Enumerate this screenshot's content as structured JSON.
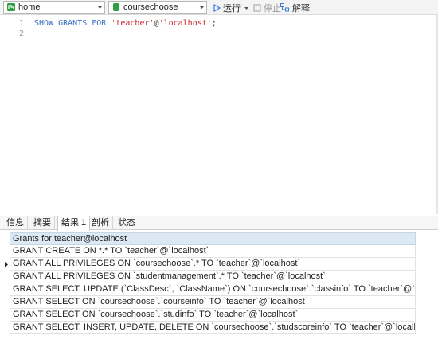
{
  "toolbar": {
    "connection": "home",
    "database": "coursechoose",
    "run_label": "运行",
    "stop_label": "停止",
    "explain_label": "解释"
  },
  "editor": {
    "line_numbers": [
      "1",
      "2"
    ],
    "line1": {
      "kw": "SHOW GRANTS FOR ",
      "str1": "'teacher'",
      "at": "@",
      "str2": "'localhost'",
      "end": ";"
    }
  },
  "tabs": [
    "信息",
    "摘要",
    "结果 1",
    "剖析",
    "状态"
  ],
  "active_tab": "结果 1",
  "results": {
    "column": "Grants for teacher@localhost",
    "selected_row": 1,
    "rows": [
      "GRANT CREATE ON *.* TO `teacher`@`localhost`",
      "GRANT ALL PRIVILEGES ON `coursechoose`.* TO `teacher`@`localhost`",
      "GRANT ALL PRIVILEGES ON `studentmanagement`.* TO `teacher`@`localhost`",
      "GRANT SELECT, UPDATE (`ClassDesc`, `ClassName`) ON `coursechoose`.`classinfo` TO `teacher`@`localhost`",
      "GRANT SELECT ON `coursechoose`.`courseinfo` TO `teacher`@`localhost`",
      "GRANT SELECT ON `coursechoose`.`studinfo` TO `teacher`@`localhost`",
      "GRANT SELECT, INSERT, UPDATE, DELETE ON `coursechoose`.`studscoreinfo` TO `teacher`@`localhost`"
    ]
  },
  "colors": {
    "connection_icon": "#2f9e44",
    "database_icon": "#2f9e44",
    "run_icon": "#3a7bd5",
    "header_bg": "#dce9f5",
    "keyword": "#3a6fc4",
    "string": "#c9242b"
  },
  "icons": {
    "connection": "connection-icon",
    "database": "database-icon",
    "run": "play-icon",
    "stop": "stop-icon",
    "explain": "explain-icon"
  }
}
